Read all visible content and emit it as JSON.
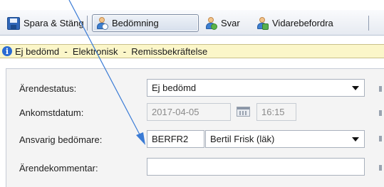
{
  "toolbar": {
    "save_label": "Spara & Stäng",
    "assess_label": "Bedömning",
    "reply_label": "Svar",
    "forward_label": "Vidarebefordra"
  },
  "infobar": {
    "text": "Ej bedömd  -  Elektronisk  -  Remissbekräftelse"
  },
  "form": {
    "status_label": "Ärendestatus:",
    "status_value": "Ej bedömd",
    "arrival_label": "Ankomstdatum:",
    "arrival_date": "2017-04-05",
    "arrival_time": "16:15",
    "assessor_label": "Ansvarig bedömare:",
    "assessor_code": "BERFR2",
    "assessor_name": "Bertil Frisk (läk)",
    "comment_label": "Ärendekommentar:",
    "comment_value": ""
  },
  "icons": {
    "save": "save-disk-icon",
    "assess": "person-assess-icon",
    "reply": "person-reply-icon",
    "forward": "person-forward-icon",
    "info": "info-icon",
    "calendar": "calendar-icon"
  },
  "colors": {
    "accent": "#2b6bd3",
    "infobar_bg": "#fbf6c9",
    "arrow": "#3a7bd5"
  }
}
